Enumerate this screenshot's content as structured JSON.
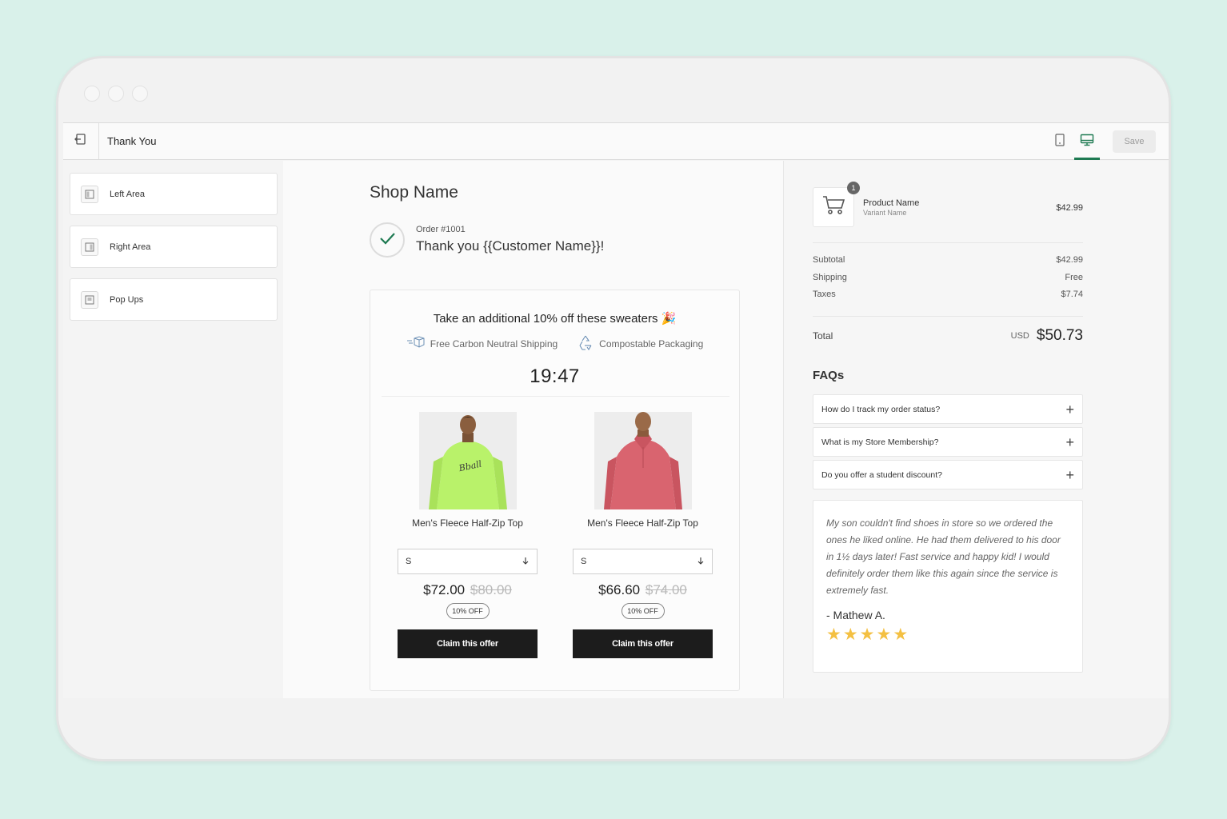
{
  "topbar": {
    "page_label": "Thank You",
    "save_label": "Save"
  },
  "sidebar": {
    "items": [
      {
        "label": "Left Area",
        "icon": "left-layout-icon"
      },
      {
        "label": "Right Area",
        "icon": "right-layout-icon"
      },
      {
        "label": "Pop Ups",
        "icon": "popup-icon"
      }
    ]
  },
  "main": {
    "shop_name": "Shop Name",
    "order_number": "Order #1001",
    "thank_you": "Thank you {{Customer Name}}!",
    "offer": {
      "title": "Take an additional 10% off these sweaters 🎉",
      "perks": [
        "Free Carbon Neutral Shipping",
        "Compostable Packaging"
      ],
      "timer": "19:47",
      "products": [
        {
          "name": "Men's Fleece Half-Zip Top",
          "size": "S",
          "price": "$72.00",
          "old_price": "$80.00",
          "badge": "10% OFF",
          "cta": "Claim this offer",
          "color": "#b9f26a"
        },
        {
          "name": "Men's Fleece Half-Zip Top",
          "size": "S",
          "price": "$66.60",
          "old_price": "$74.00",
          "badge": "10% OFF",
          "cta": "Claim this offer",
          "color": "#d9646f"
        }
      ]
    }
  },
  "summary": {
    "line_item": {
      "name": "Product Name",
      "variant": "Variant Name",
      "price": "$42.99",
      "qty": "1"
    },
    "rows": [
      {
        "label": "Subtotal",
        "value": "$42.99"
      },
      {
        "label": "Shipping",
        "value": "Free"
      },
      {
        "label": "Taxes",
        "value": "$7.74"
      }
    ],
    "total_label": "Total",
    "currency": "USD",
    "total": "$50.73"
  },
  "faqs": {
    "title": "FAQs",
    "items": [
      "How do I track my order status?",
      "What is my Store Membership?",
      "Do you offer a student discount?"
    ]
  },
  "review": {
    "text": "My son couldn't find shoes in store so we ordered the ones he liked online. He had them delivered to his door in 1½ days later! Fast service and happy kid! I would definitely order them like this again since the service is extremely fast.",
    "author": "- Mathew A.",
    "rating": 5
  },
  "colors": {
    "accent": "#1e7a52",
    "button_dark": "#1c1c1c",
    "star": "#f4c042"
  }
}
